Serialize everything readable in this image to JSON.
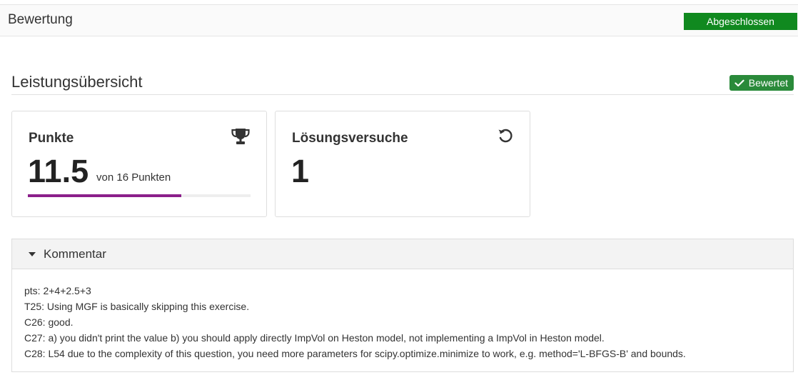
{
  "header": {
    "title": "Bewertung",
    "status_label": "Abgeschlossen",
    "status_color": "#10891f"
  },
  "overview": {
    "heading": "Leistungsübersicht",
    "badge_label": "Bewertet",
    "badge_icon": "check-icon"
  },
  "points_card": {
    "title": "Punkte",
    "icon": "trophy-icon",
    "value": "11.5",
    "of_text": "von 16 Punkten",
    "progress_fraction": 0.69,
    "progress_color": "#8b1f8a"
  },
  "attempts_card": {
    "title": "Lösungsversuche",
    "icon": "reload-icon",
    "value": "1"
  },
  "comment": {
    "label": "Kommentar",
    "expanded": true,
    "lines": [
      "pts: 2+4+2.5+3",
      "T25: Using MGF is basically skipping this exercise.",
      "C26: good.",
      "C27: a) you didn't print the value b) you should apply directly ImpVol on Heston model, not implementing a ImpVol in Heston model.",
      "C28: L54 due to the complexity of this question, you need more parameters for scipy.optimize.minimize to work, e.g. method='L-BFGS-B' and bounds."
    ]
  }
}
